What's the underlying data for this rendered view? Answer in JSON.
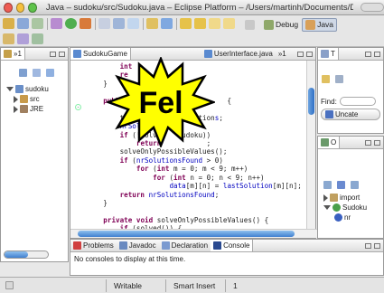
{
  "window": {
    "title": "Java – sudoku/src/Sudoku.java – Eclipse Platform – /Users/martinh/Documents/Diverse/sudoko"
  },
  "perspectives": {
    "debug_label": "Debug",
    "java_label": "Java"
  },
  "left_panel": {
    "tab_label": "»1",
    "tree": [
      {
        "label": "sudoku",
        "expanded": true
      },
      {
        "label": "src",
        "expanded": false
      },
      {
        "label": "JRE",
        "expanded": false
      }
    ]
  },
  "editor": {
    "tabs": [
      {
        "label": "SudokuGame"
      },
      {
        "label": "UserInterface.java"
      },
      {
        "label": "»1"
      }
    ],
    "code_lines": [
      {
        "segments": [
          {
            "t": "        int",
            "c": "kw"
          }
        ]
      },
      {
        "segments": [
          {
            "t": "        re",
            "c": "kw"
          }
        ]
      },
      {
        "segments": [
          {
            "t": "    }",
            "c": ""
          }
        ]
      },
      {
        "segments": [
          {
            "t": "",
            "c": ""
          }
        ]
      },
      {
        "segments": [
          {
            "t": "    public ",
            "c": "kw"
          },
          {
            "t": "                       {",
            "c": ""
          }
        ]
      },
      {
        "segments": [
          {
            "t": "        ",
            "c": ""
          },
          {
            "t": "",
            "c": ""
          }
        ]
      },
      {
        "segments": [
          {
            "t": "        this.",
            "c": ""
          },
          {
            "t": "m",
            "c": "fld"
          },
          {
            "t": "          olution",
            "c": ""
          },
          {
            "t": "s",
            "c": "fld"
          },
          {
            "t": ";",
            "c": ""
          }
        ]
      },
      {
        "segments": [
          {
            "t": "        ",
            "c": ""
          },
          {
            "t": "nrSolu",
            "c": "fld"
          },
          {
            "t": "          ",
            "c": ""
          }
        ]
      },
      {
        "segments": [
          {
            "t": "        ",
            "c": ""
          },
          {
            "t": "if",
            "c": "kw"
          },
          {
            "t": " (!solved",
            "c": ""
          },
          {
            "t": "    udok",
            "c": ""
          },
          {
            "t": "u",
            "c": ""
          },
          {
            "t": "))",
            "c": ""
          }
        ]
      },
      {
        "segments": [
          {
            "t": "            ",
            "c": ""
          },
          {
            "t": "return",
            "c": "kw"
          },
          {
            "t": "  ",
            "c": ""
          },
          {
            "t": "         ;",
            "c": ""
          }
        ]
      },
      {
        "segments": [
          {
            "t": "        solveOnlyPossibleValues();",
            "c": ""
          }
        ]
      },
      {
        "segments": [
          {
            "t": "        ",
            "c": ""
          },
          {
            "t": "if",
            "c": "kw"
          },
          {
            "t": " (",
            "c": ""
          },
          {
            "t": "nrSolutionsFound",
            "c": "fld"
          },
          {
            "t": " > 0)",
            "c": ""
          }
        ]
      },
      {
        "segments": [
          {
            "t": "            ",
            "c": ""
          },
          {
            "t": "for",
            "c": "kw"
          },
          {
            "t": " (",
            "c": ""
          },
          {
            "t": "int",
            "c": "kw"
          },
          {
            "t": " m = 0; m < 9; m++)",
            "c": ""
          }
        ]
      },
      {
        "segments": [
          {
            "t": "                ",
            "c": ""
          },
          {
            "t": "for",
            "c": "kw"
          },
          {
            "t": " (",
            "c": ""
          },
          {
            "t": "int",
            "c": "kw"
          },
          {
            "t": " n = 0; n < 9; n++)",
            "c": ""
          }
        ]
      },
      {
        "segments": [
          {
            "t": "                    ",
            "c": ""
          },
          {
            "t": "data",
            "c": "fld"
          },
          {
            "t": "[m][n] = ",
            "c": ""
          },
          {
            "t": "lastSolution",
            "c": "fld"
          },
          {
            "t": "[m][n];",
            "c": ""
          }
        ]
      },
      {
        "segments": [
          {
            "t": "        ",
            "c": ""
          },
          {
            "t": "return",
            "c": "kw"
          },
          {
            "t": " ",
            "c": ""
          },
          {
            "t": "nrSolutionsFound",
            "c": "fld"
          },
          {
            "t": ";",
            "c": ""
          }
        ]
      },
      {
        "segments": [
          {
            "t": "    }",
            "c": ""
          }
        ]
      },
      {
        "segments": [
          {
            "t": "",
            "c": ""
          }
        ]
      },
      {
        "segments": [
          {
            "t": "    ",
            "c": ""
          },
          {
            "t": "private void",
            "c": "kw"
          },
          {
            "t": " solveOnlyPossibleValues() {",
            "c": ""
          }
        ]
      },
      {
        "segments": [
          {
            "t": "        ",
            "c": ""
          },
          {
            "t": "if",
            "c": "kw"
          },
          {
            "t": " (solved()) {",
            "c": ""
          }
        ]
      },
      {
        "segments": [
          {
            "t": "            ",
            "c": ""
          },
          {
            "t": "nrSolutionsFound",
            "c": "fld"
          },
          {
            "t": " = 1;",
            "c": ""
          }
        ]
      }
    ]
  },
  "overlay": {
    "label": "Fel",
    "color": "#ffff00"
  },
  "console": {
    "tabs": [
      {
        "label": "Problems"
      },
      {
        "label": "Javadoc"
      },
      {
        "label": "Declaration"
      },
      {
        "label": "Console"
      }
    ],
    "message": "No consoles to display at this time."
  },
  "right_top": {
    "tab_label": "T",
    "find_label": "Find:",
    "button_label": "Uncate"
  },
  "right_bottom": {
    "tab_label": "O",
    "tree": [
      {
        "label": "import"
      },
      {
        "label": "Sudoku"
      },
      {
        "label": "nr"
      }
    ]
  },
  "statusbar": {
    "writable": "Writable",
    "insert_mode": "Smart Insert",
    "position": "1"
  }
}
